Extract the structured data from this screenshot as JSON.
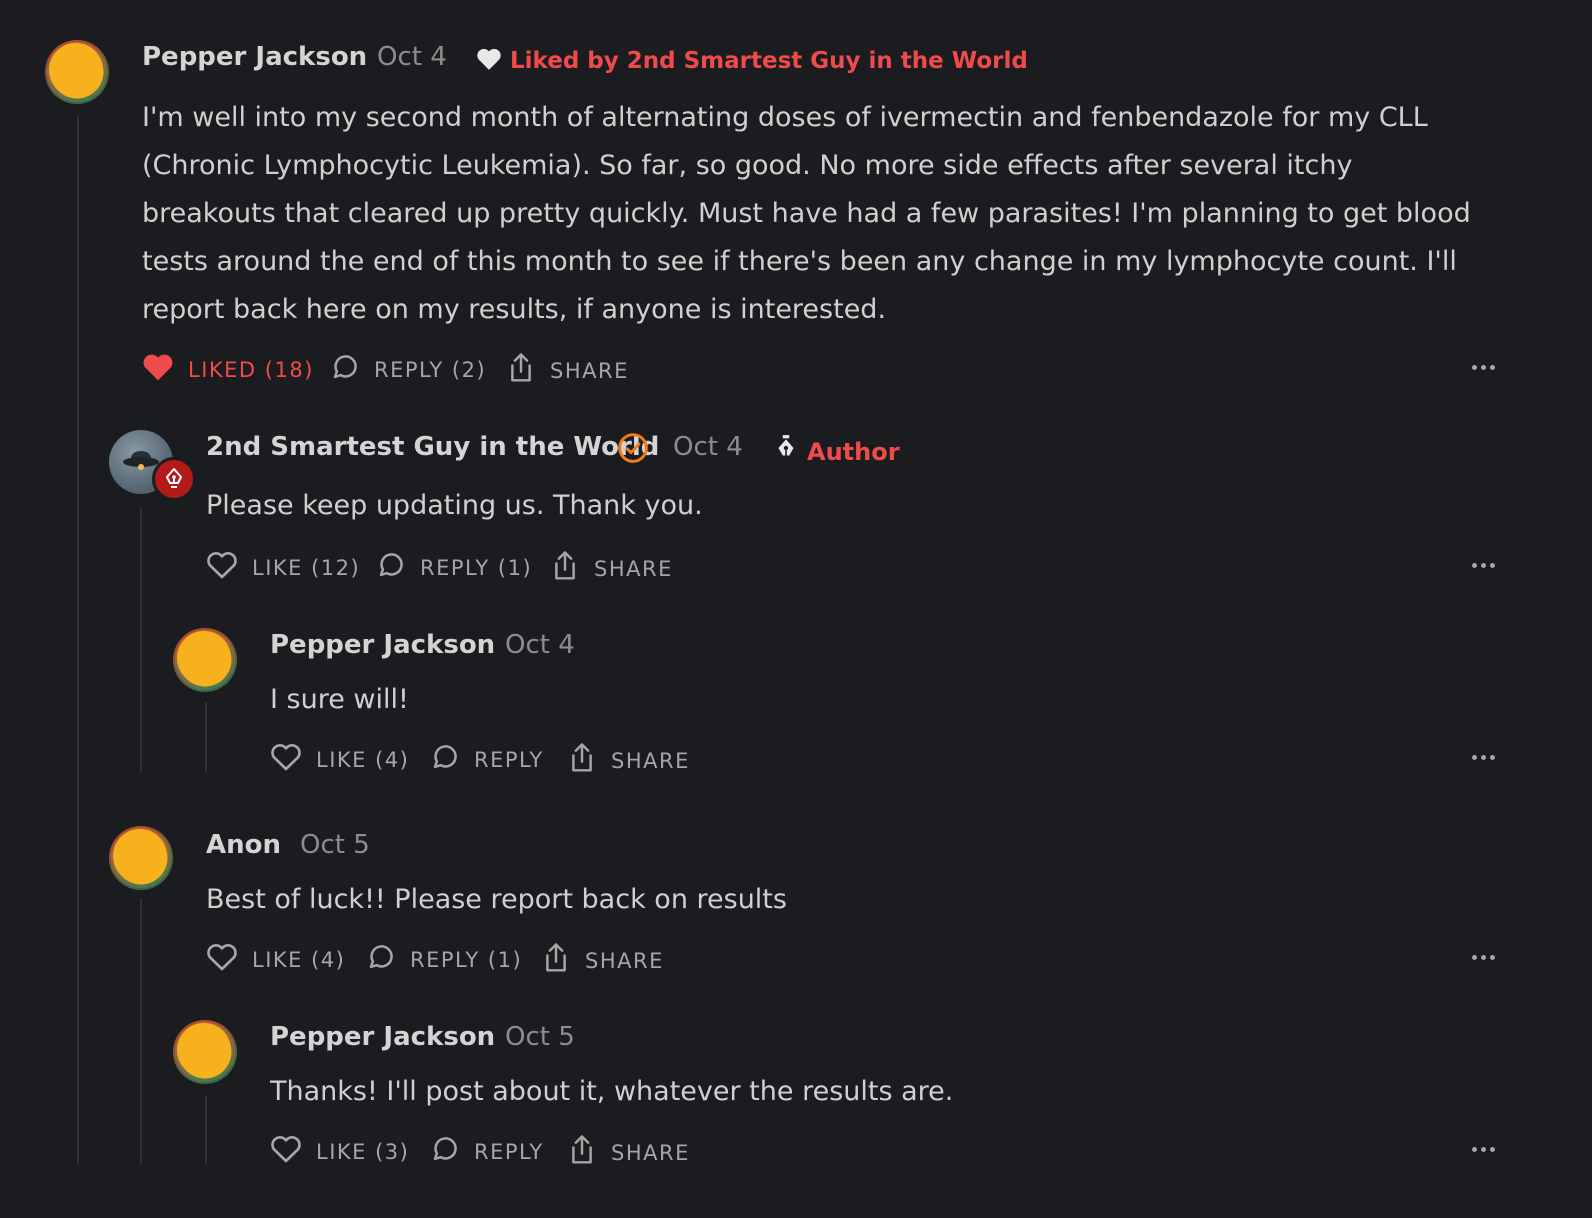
{
  "comments": [
    {
      "name": "Pepper Jackson",
      "date": "Oct 4",
      "liked_by": "Liked by 2nd Smartest Guy in the World",
      "body": "I'm well into my second month of alternating doses of ivermectin and fenbendazole for my CLL (Chronic Lymphocytic Leukemia). So far, so good. No more side effects after several itchy breakouts that cleared up pretty quickly. Must have had a few parasites! I'm planning to get blood tests around the end of this month to see if there's been any change in my lymphocyte count. I'll report back here on my results, if anyone is interested.",
      "like": "LIKED (18)",
      "reply": "REPLY (2)",
      "share": "SHARE"
    },
    {
      "name": "2nd Smartest Guy in the World",
      "date": "Oct 4",
      "author_label": "Author",
      "body": "Please keep updating us. Thank you.",
      "like": "LIKE (12)",
      "reply": "REPLY (1)",
      "share": "SHARE"
    },
    {
      "name": "Pepper Jackson",
      "date": "Oct 4",
      "body": "I sure will!",
      "like": "LIKE (4)",
      "reply": "REPLY",
      "share": "SHARE"
    },
    {
      "name": "Anon",
      "date": "Oct 5",
      "body": "Best of luck!! Please report back on results",
      "like": "LIKE (4)",
      "reply": "REPLY (1)",
      "share": "SHARE"
    },
    {
      "name": "Pepper Jackson",
      "date": "Oct 5",
      "body": "Thanks! I'll post about it, whatever the results are.",
      "like": "LIKE (3)",
      "reply": "REPLY",
      "share": "SHARE"
    }
  ],
  "icons": {
    "heart": "heart-icon",
    "reply": "speech-bubble-icon",
    "share": "share-icon",
    "more": "more-horizontal-icon",
    "verified": "verified-check-icon",
    "pen": "fountain-pen-icon"
  },
  "colors": {
    "background": "#1b1c1f",
    "accent": "#ef4b4b",
    "verified": "#f07b1a",
    "muted": "#8d8d8d"
  }
}
